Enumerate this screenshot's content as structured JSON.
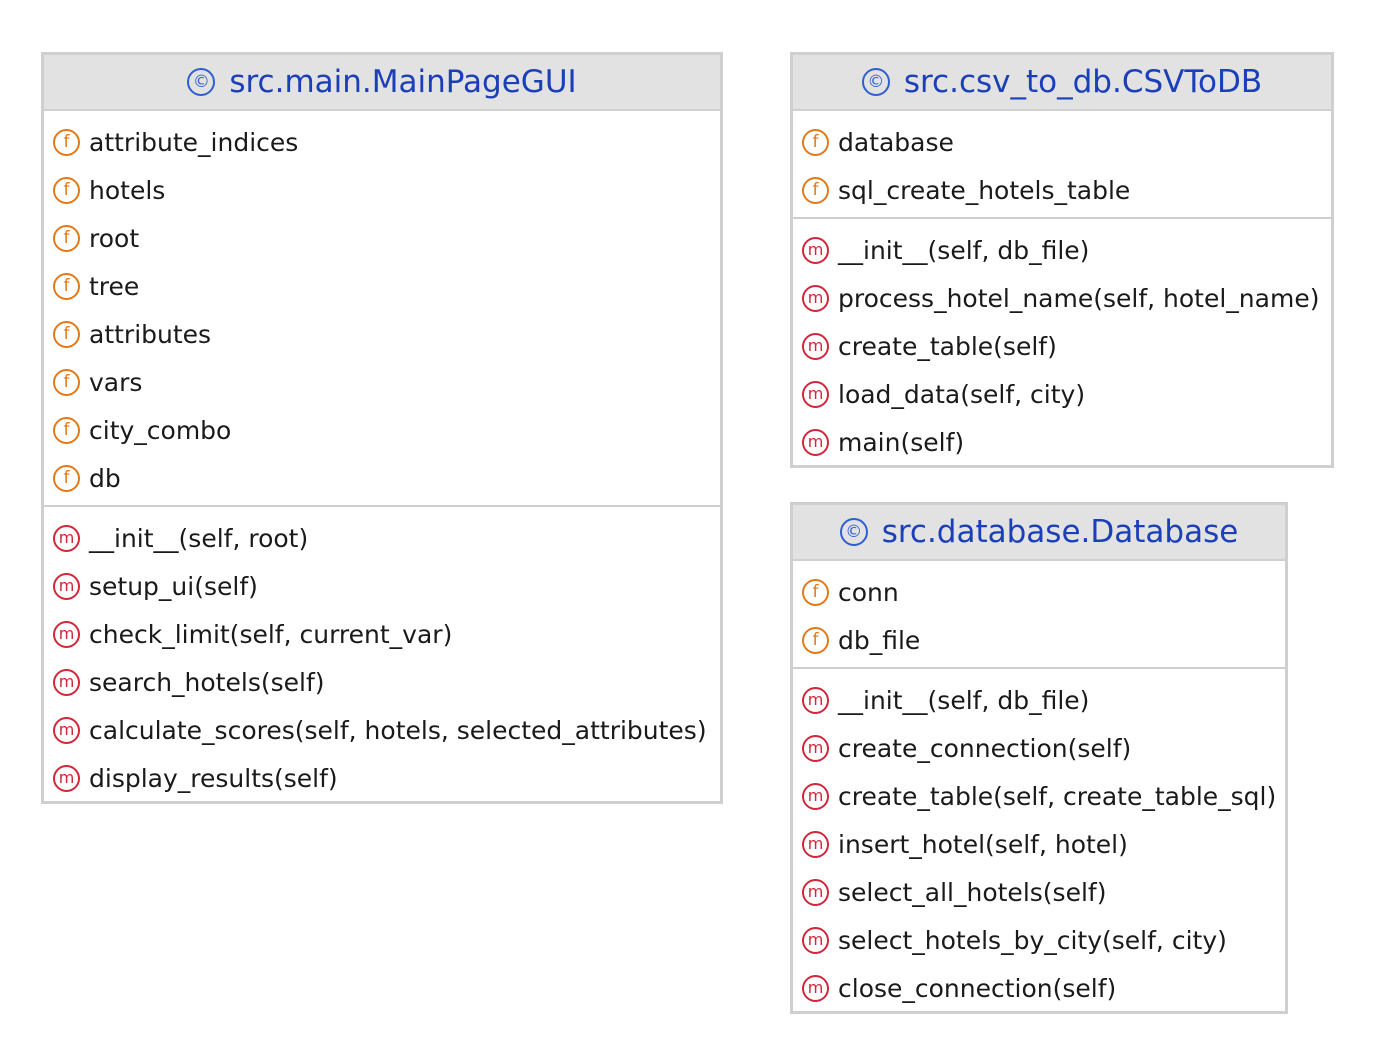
{
  "icons": {
    "class_glyph": "©",
    "field_glyph": "f",
    "method_glyph": "m",
    "class_icon_name": "class-icon",
    "field_icon_name": "field-icon",
    "method_icon_name": "method-icon"
  },
  "colors": {
    "class_name": "#1a3fb8",
    "class_icon": "#2f5fd0",
    "field_icon": "#e07a1a",
    "method_icon": "#d0273a",
    "header_bg": "#e2e2e2",
    "border": "#cfcfcf"
  },
  "classes": [
    {
      "name": "src.main.MainPageGUI",
      "fields": [
        "attribute_indices",
        "hotels",
        "root",
        "tree",
        "attributes",
        "vars",
        "city_combo",
        "db"
      ],
      "methods": [
        "__init__(self, root)",
        "setup_ui(self)",
        "check_limit(self, current_var)",
        "search_hotels(self)",
        "calculate_scores(self, hotels, selected_attributes)",
        "display_results(self)"
      ]
    },
    {
      "name": "src.csv_to_db.CSVToDB",
      "fields": [
        "database",
        "sql_create_hotels_table"
      ],
      "methods": [
        "__init__(self, db_file)",
        "process_hotel_name(self, hotel_name)",
        "create_table(self)",
        "load_data(self, city)",
        "main(self)"
      ]
    },
    {
      "name": "src.database.Database",
      "fields": [
        "conn",
        "db_file"
      ],
      "methods": [
        "__init__(self, db_file)",
        "create_connection(self)",
        "create_table(self, create_table_sql)",
        "insert_hotel(self, hotel)",
        "select_all_hotels(self)",
        "select_hotels_by_city(self, city)",
        "close_connection(self)"
      ]
    }
  ]
}
